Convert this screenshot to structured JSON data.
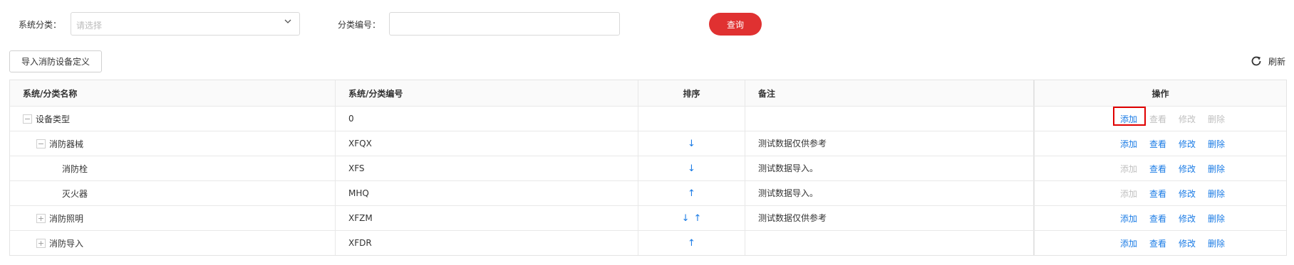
{
  "filters": {
    "category_label": "系统分类：",
    "category_placeholder": "请选择",
    "code_label": "分类编号：",
    "code_value": "",
    "query_label": "查询"
  },
  "toolbar": {
    "import_label": "导入消防设备定义",
    "refresh_label": "刷新"
  },
  "table": {
    "headers": [
      "系统/分类名称",
      "系统/分类编号",
      "排序",
      "备注",
      "操作"
    ],
    "rows": [
      {
        "name": "设备类型",
        "code": "0",
        "remark": "",
        "toggle": "−",
        "add": "添加",
        "view": "查看",
        "edit": "修改",
        "delete": "删除"
      },
      {
        "name": "消防器械",
        "code": "XFQX",
        "remark": "测试数据仅供参考",
        "toggle": "−",
        "add": "添加",
        "view": "查看",
        "edit": "修改",
        "delete": "删除"
      },
      {
        "name": "消防栓",
        "code": "XFS",
        "remark": "测试数据导入。",
        "toggle": "",
        "add": "添加",
        "view": "查看",
        "edit": "修改",
        "delete": "删除"
      },
      {
        "name": "灭火器",
        "code": "MHQ",
        "remark": "测试数据导入。",
        "toggle": "",
        "add": "添加",
        "view": "查看",
        "edit": "修改",
        "delete": "删除"
      },
      {
        "name": "消防照明",
        "code": "XFZM",
        "remark": "测试数据仅供参考",
        "toggle": "+",
        "add": "添加",
        "view": "查看",
        "edit": "修改",
        "delete": "删除"
      },
      {
        "name": "消防导入",
        "code": "XFDR",
        "remark": "",
        "toggle": "+",
        "add": "添加",
        "view": "查看",
        "edit": "修改",
        "delete": "删除"
      }
    ]
  },
  "colors": {
    "accent": "#1a7be5",
    "query_button": "#e03131",
    "disabled": "#c0c0c0",
    "highlight": "#e00000"
  }
}
